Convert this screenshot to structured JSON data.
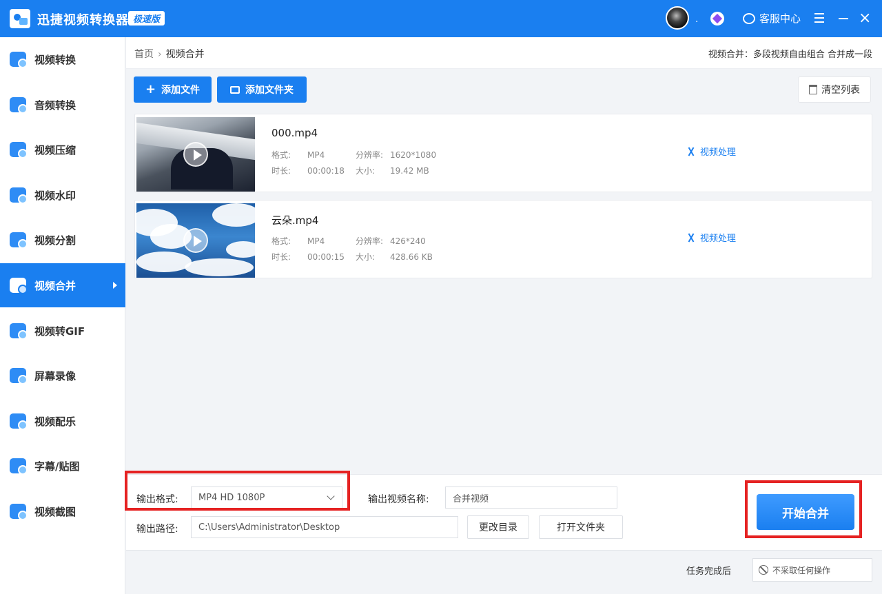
{
  "app": {
    "title": "迅捷视频转换器",
    "badge": "极速版",
    "dot": ".",
    "service_label": "客服中心"
  },
  "sidebar": {
    "items": [
      {
        "label": "视频转换",
        "icon": "video-convert-icon"
      },
      {
        "label": "音频转换",
        "icon": "audio-convert-icon"
      },
      {
        "label": "视频压缩",
        "icon": "video-compress-icon"
      },
      {
        "label": "视频水印",
        "icon": "video-watermark-icon"
      },
      {
        "label": "视频分割",
        "icon": "video-split-icon"
      },
      {
        "label": "视频合并",
        "icon": "video-merge-icon",
        "active": true
      },
      {
        "label": "视频转GIF",
        "icon": "video-gif-icon"
      },
      {
        "label": "屏幕录像",
        "icon": "screen-record-icon"
      },
      {
        "label": "视频配乐",
        "icon": "video-music-icon"
      },
      {
        "label": "字幕/贴图",
        "icon": "subtitle-sticker-icon"
      },
      {
        "label": "视频截图",
        "icon": "video-screenshot-icon"
      }
    ]
  },
  "header": {
    "breadcrumb_home": "首页",
    "breadcrumb_sep": "›",
    "breadcrumb_current": "视频合并",
    "hint": "视频合并：多段视频自由组合 合并成一段"
  },
  "toolbar": {
    "add_file": "添加文件",
    "add_folder": "添加文件夹",
    "clear_list": "清空列表"
  },
  "files": [
    {
      "name": "000.mp4",
      "format_label": "格式:",
      "format": "MP4",
      "resolution_label": "分辨率:",
      "resolution": "1620*1080",
      "duration_label": "时长:",
      "duration": "00:00:18",
      "size_label": "大小:",
      "size": "19.42 MB",
      "action": "视频处理"
    },
    {
      "name": "云朵.mp4",
      "format_label": "格式:",
      "format": "MP4",
      "resolution_label": "分辨率:",
      "resolution": "426*240",
      "duration_label": "时长:",
      "duration": "00:00:15",
      "size_label": "大小:",
      "size": "428.66 KB",
      "action": "视频处理"
    }
  ],
  "output": {
    "format_label": "输出格式:",
    "format_value": "MP4  HD 1080P",
    "name_label": "输出视频名称:",
    "name_value": "合并视频",
    "path_label": "输出路径:",
    "path_value": "C:\\Users\\Administrator\\Desktop",
    "change_dir": "更改目录",
    "open_folder": "打开文件夹",
    "start": "开始合并"
  },
  "footer": {
    "after_label": "任务完成后",
    "after_value": "不采取任何操作"
  },
  "colors": {
    "accent": "#1a7ff0",
    "highlight": "#e52222"
  }
}
